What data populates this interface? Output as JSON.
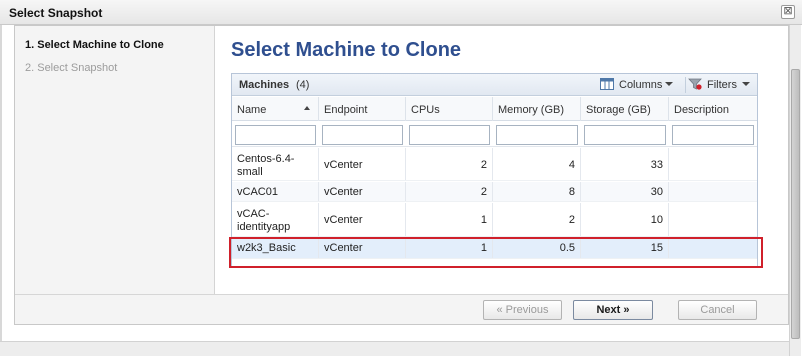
{
  "window": {
    "title": "Select Snapshot",
    "close_glyph": "⊠"
  },
  "steps": [
    {
      "label": "1. Select Machine to Clone",
      "active": true
    },
    {
      "label": "2. Select Snapshot",
      "active": false
    }
  ],
  "page": {
    "heading": "Select Machine to Clone"
  },
  "grid": {
    "title": "Machines",
    "count": "(4)",
    "columns_button": "Columns",
    "filters_button": "Filters",
    "columns": [
      "Name",
      "Endpoint",
      "CPUs",
      "Memory (GB)",
      "Storage (GB)",
      "Description"
    ],
    "sorted_column": "Name",
    "rows": [
      {
        "name_line1": "Centos-6.4-",
        "name_line2": "small",
        "endpoint": "vCenter",
        "cpus": "2",
        "memory": "4",
        "storage": "33",
        "description": ""
      },
      {
        "name_line1": "vCAC01",
        "name_line2": "",
        "endpoint": "vCenter",
        "cpus": "2",
        "memory": "8",
        "storage": "30",
        "description": ""
      },
      {
        "name_line1": "vCAC-",
        "name_line2": "identityapp",
        "endpoint": "vCenter",
        "cpus": "1",
        "memory": "2",
        "storage": "10",
        "description": ""
      },
      {
        "name_line1": "w2k3_Basic",
        "name_line2": "",
        "endpoint": "vCenter",
        "cpus": "1",
        "memory": "0.5",
        "storage": "15",
        "description": ""
      }
    ],
    "selected_row": 3
  },
  "buttons": {
    "previous": "« Previous",
    "next": "Next »",
    "cancel": "Cancel"
  },
  "colors": {
    "heading": "#2f4f8f",
    "selection_outline": "#d0202b",
    "selected_row": "#e3eefb"
  }
}
